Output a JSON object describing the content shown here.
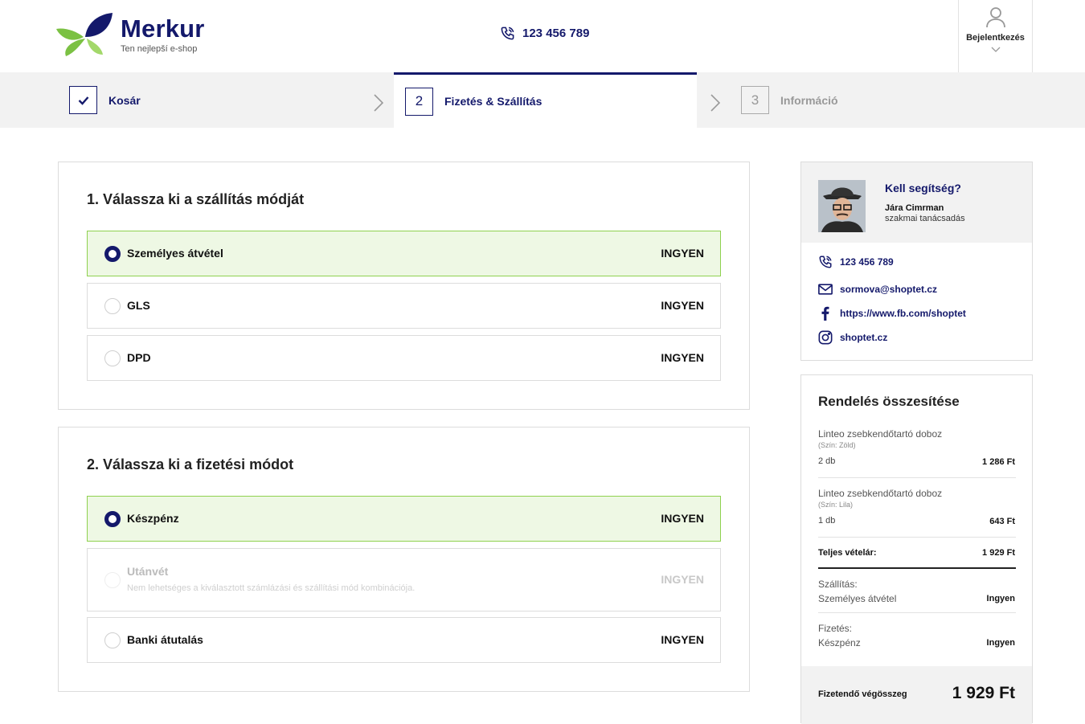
{
  "brand": {
    "name": "Merkur",
    "tagline": "Ten nejlepší e-shop",
    "colors": {
      "primary": "#14196b",
      "leaf_blue": "#14196b",
      "leaf_green": "#7bc143",
      "selected_bg": "#eef8e4",
      "selected_border": "#8fd14f"
    }
  },
  "header": {
    "phone": "123 456 789",
    "phone_icon": "phone-icon",
    "login_label": "Bejelentkezés",
    "login_icon": "user-icon"
  },
  "steps": [
    {
      "marker": "✓",
      "label": "Kosár",
      "state": "done"
    },
    {
      "marker": "2",
      "label": "Fizetés & Szállítás",
      "state": "active"
    },
    {
      "marker": "3",
      "label": "Információ",
      "state": "upcoming"
    }
  ],
  "shipping": {
    "title": "1. Válassza ki a szállítás módját",
    "options": [
      {
        "label": "Személyes átvétel",
        "price": "INGYEN",
        "selected": true
      },
      {
        "label": "GLS",
        "price": "INGYEN",
        "selected": false
      },
      {
        "label": "DPD",
        "price": "INGYEN",
        "selected": false
      }
    ]
  },
  "payment": {
    "title": "2. Válassza ki a fizetési módot",
    "options": [
      {
        "label": "Készpénz",
        "price": "INGYEN",
        "selected": true
      },
      {
        "label": "Utánvét",
        "note": "Nem lehetséges a kiválasztott számlázási és szállítási mód kombinációja.",
        "price": "INGYEN",
        "selected": false,
        "disabled": true
      },
      {
        "label": "Banki átutalás",
        "price": "INGYEN",
        "selected": false
      }
    ]
  },
  "help": {
    "title": "Kell segítség?",
    "name": "Jára Cimrman",
    "role": "szakmai tanácsadás",
    "contacts": [
      {
        "icon": "phone-icon",
        "text": "123 456 789"
      },
      {
        "icon": "mail-icon",
        "text": "sormova@shoptet.cz"
      },
      {
        "icon": "facebook-icon",
        "text": "https://www.fb.com/shoptet"
      },
      {
        "icon": "instagram-icon",
        "text": "shoptet.cz"
      }
    ]
  },
  "summary": {
    "title": "Rendelés összesítése",
    "items": [
      {
        "name": "Linteo zsebkendőtartó doboz",
        "variant": "(Szín: Zöld)",
        "qty": "2 db",
        "price": "1 286 Ft"
      },
      {
        "name": "Linteo zsebkendőtartó doboz",
        "variant": "(Szín: Lila)",
        "qty": "1 db",
        "price": "643 Ft"
      }
    ],
    "total_label": "Teljes vételár:",
    "total_value": "1 929 Ft",
    "shipping_label": "Szállítás:",
    "shipping_value": "Személyes átvétel",
    "shipping_price": "Ingyen",
    "payment_label": "Fizetés:",
    "payment_value": "Készpénz",
    "payment_price": "Ingyen",
    "final_label": "Fizetendő végösszeg",
    "final_value": "1 929 Ft"
  }
}
